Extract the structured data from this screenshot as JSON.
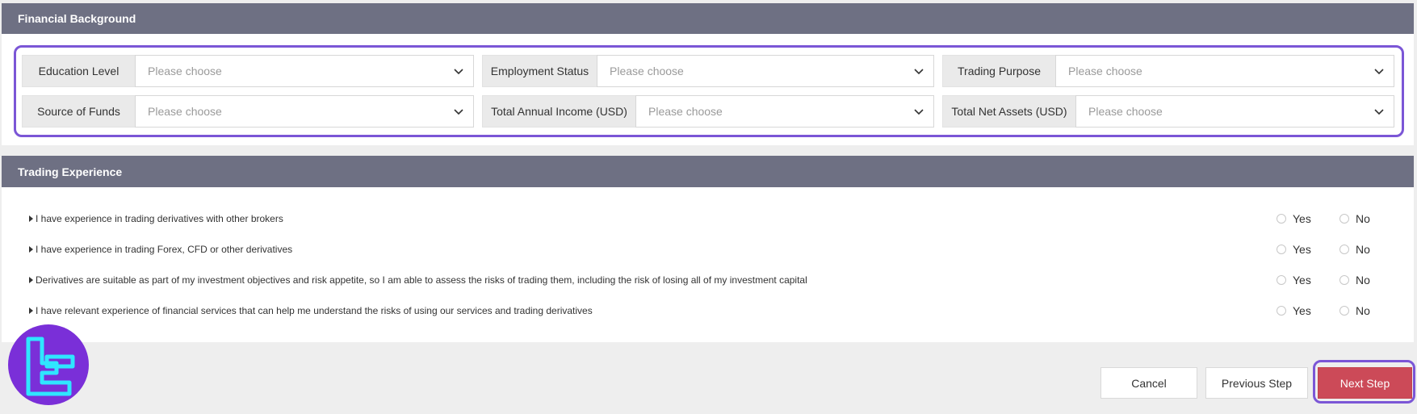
{
  "financial": {
    "header": "Financial Background",
    "fields": [
      {
        "label": "Education Level",
        "placeholder": "Please choose"
      },
      {
        "label": "Employment Status",
        "placeholder": "Please choose"
      },
      {
        "label": "Trading Purpose",
        "placeholder": "Please choose"
      },
      {
        "label": "Source of Funds",
        "placeholder": "Please choose"
      },
      {
        "label": "Total Annual Income (USD)",
        "placeholder": "Please choose"
      },
      {
        "label": "Total Net Assets (USD)",
        "placeholder": "Please choose"
      }
    ]
  },
  "trading": {
    "header": "Trading Experience",
    "yes_label": "Yes",
    "no_label": "No",
    "questions": [
      "I have experience in trading derivatives with other brokers",
      "I have experience in trading Forex, CFD or other derivatives",
      "Derivatives are suitable as part of my investment objectives and risk appetite, so I am able to assess the risks of trading them, including the risk of losing all of my investment capital",
      "I have relevant experience of financial services that can help me understand the risks of using our services and trading derivatives"
    ]
  },
  "actions": {
    "cancel": "Cancel",
    "previous": "Previous Step",
    "next": "Next Step"
  },
  "colors": {
    "header_bg": "#6e7083",
    "highlight": "#7b56d6",
    "next_button": "#cc4a58",
    "logo_bg": "#7a2fd8",
    "logo_fg": "#2fe6ff"
  },
  "icons": {
    "dropdown": "chevron-down-icon",
    "bullet": "triangle-right-icon",
    "logo": "brand-logo-icon"
  }
}
